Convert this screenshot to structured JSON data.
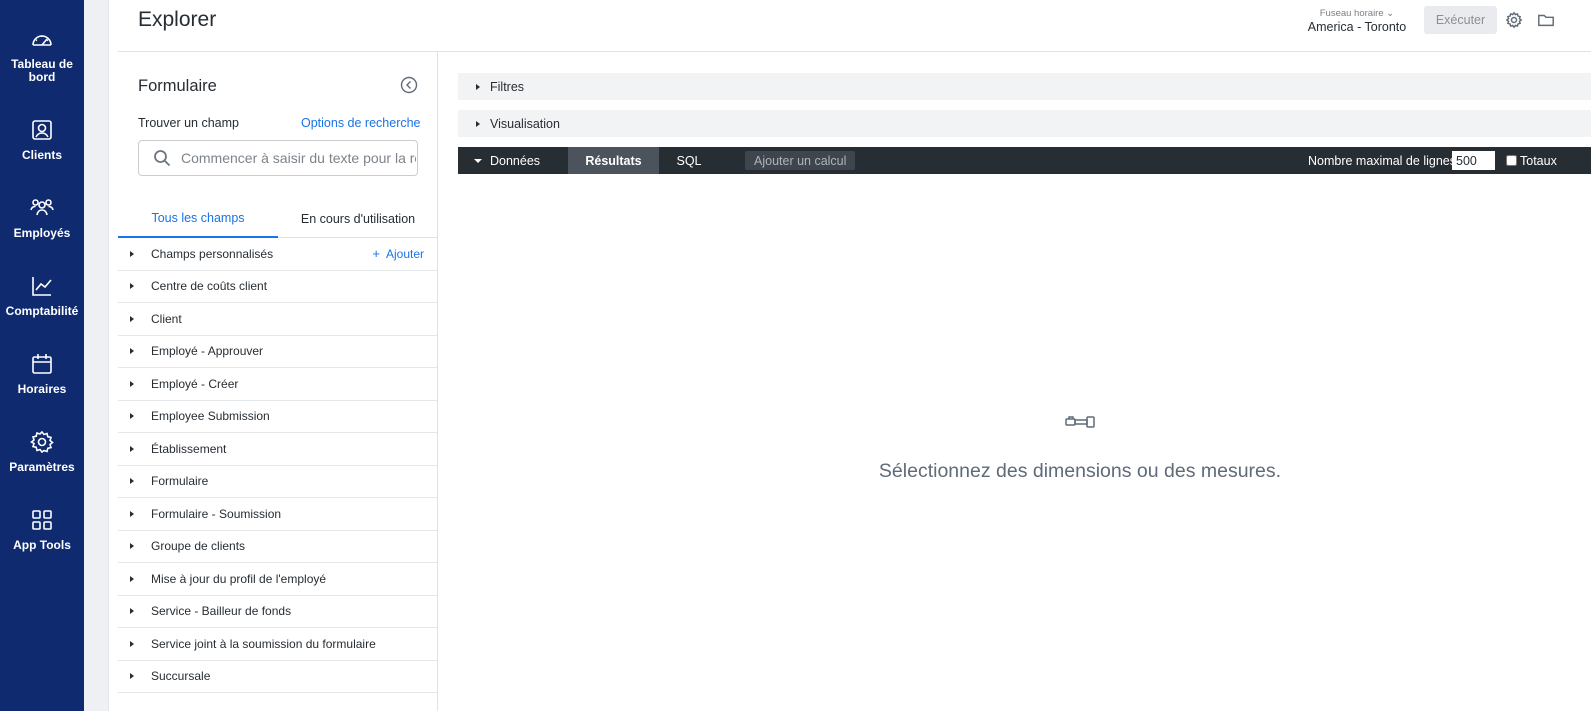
{
  "nav": {
    "items": [
      {
        "label": "Tableau de bord",
        "icon": "dashboard-gauge-icon"
      },
      {
        "label": "Clients",
        "icon": "client-card-icon"
      },
      {
        "label": "Employés",
        "icon": "employees-group-icon"
      },
      {
        "label": "Comptabilité",
        "icon": "accounting-chart-icon"
      },
      {
        "label": "Horaires",
        "icon": "calendar-icon"
      },
      {
        "label": "Paramètres",
        "icon": "settings-gear-icon"
      },
      {
        "label": "App Tools",
        "icon": "app-grid-icon"
      }
    ]
  },
  "header": {
    "title": "Explorer",
    "timezone_label": "Fuseau horaire",
    "timezone_value": "America - Toronto",
    "run_label": "Exécuter"
  },
  "picker": {
    "title": "Formulaire",
    "find_label": "Trouver un champ",
    "search_options": "Options de recherche",
    "search_placeholder": "Commencer à saisir du texte pour la recherche",
    "tab_all": "Tous les champs",
    "tab_in_use": "En cours d'utilisation",
    "add_label": "Ajouter",
    "views": [
      "Champs personnalisés",
      "Centre de coûts client",
      "Client",
      "Employé - Approuver",
      "Employé - Créer",
      "Employee Submission",
      "Établissement",
      "Formulaire",
      "Formulaire - Soumission",
      "Groupe de clients",
      "Mise à jour du profil de l'employé",
      "Service - Bailleur de fonds",
      "Service joint à la soumission du formulaire",
      "Succursale"
    ]
  },
  "main": {
    "filters_label": "Filtres",
    "visualization_label": "Visualisation",
    "data_label": "Données",
    "results_tab": "Résultats",
    "sql_tab": "SQL",
    "add_calc": "Ajouter un calcul",
    "row_limit_label": "Nombre maximal de lignes",
    "row_limit_value": "500",
    "totals_label": "Totaux",
    "empty_message": "Sélectionnez des dimensions ou des mesures."
  }
}
